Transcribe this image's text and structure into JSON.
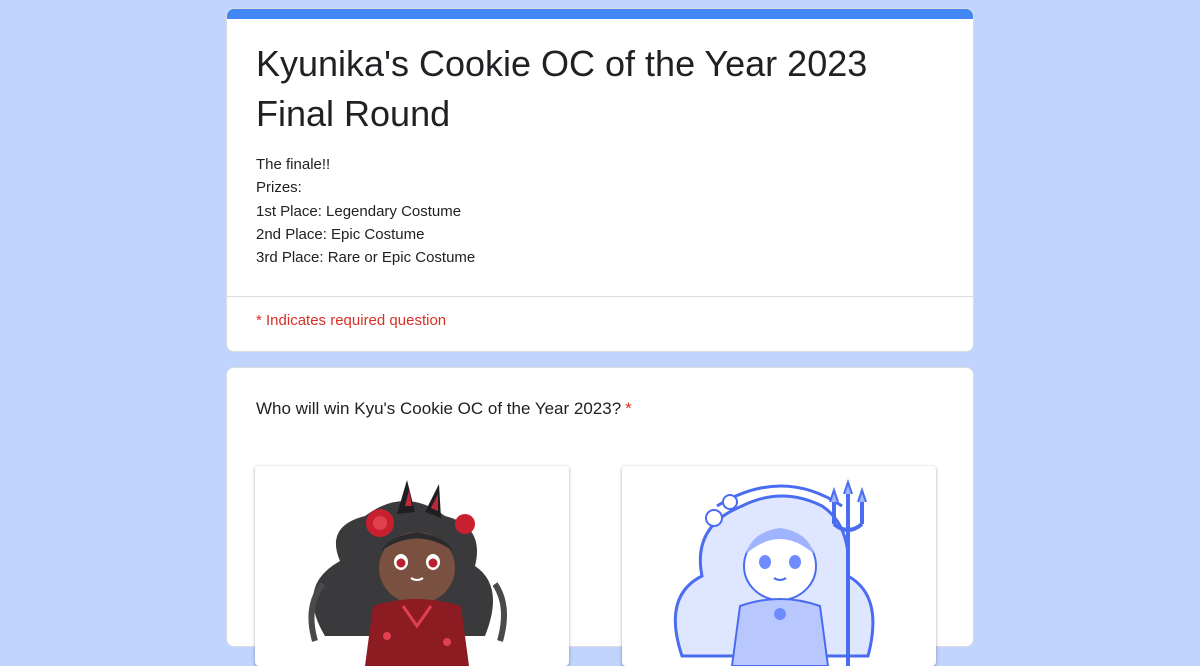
{
  "form": {
    "title": "Kyunika's Cookie OC of the Year 2023 Final Round",
    "description_lines": [
      "The finale!!",
      "Prizes:",
      "1st Place: Legendary Costume",
      "2nd Place: Epic Costume",
      "3rd Place: Rare or Epic Costume"
    ],
    "required_note": "* Indicates required question"
  },
  "question": {
    "text": "Who will win Kyu's Cookie OC of the Year 2023?",
    "required_marker": "*"
  },
  "colors": {
    "background": "#c0d4fd",
    "accent": "#4285f4",
    "required": "#d93025"
  }
}
